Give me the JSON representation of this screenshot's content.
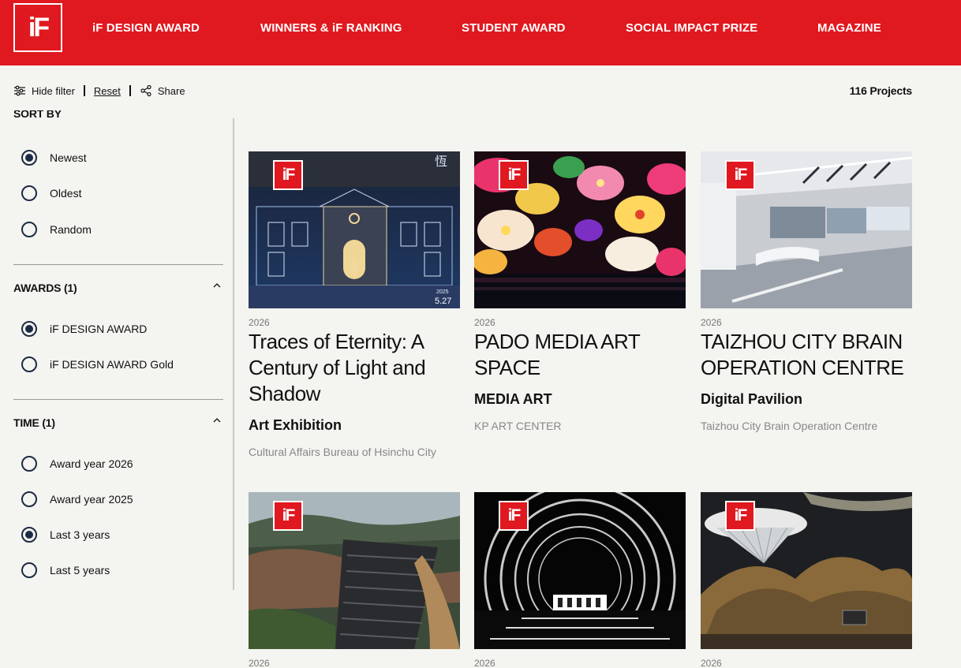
{
  "header": {
    "logo_text": "iF",
    "nav": [
      "iF DESIGN AWARD",
      "WINNERS & iF RANKING",
      "STUDENT AWARD",
      "SOCIAL IMPACT PRIZE",
      "MAGAZINE"
    ]
  },
  "toolbar": {
    "hide_filter": "Hide filter",
    "reset": "Reset",
    "share": "Share",
    "projects_count": "116 Projects"
  },
  "sidebar": {
    "sort_title": "SORT BY",
    "sort_options": [
      "Newest",
      "Oldest",
      "Random"
    ],
    "awards_title": "AWARDS (1)",
    "awards_options": [
      "iF DESIGN AWARD",
      "iF DESIGN AWARD Gold"
    ],
    "time_title": "TIME (1)",
    "time_options": [
      "Award year 2026",
      "Award year 2025",
      "Last 3 years",
      "Last 5 years"
    ]
  },
  "cards": [
    {
      "year": "2026",
      "title": "Traces of Eternity: A Century of Light and Shadow",
      "category": "Art Exhibition",
      "client": "Cultural Affairs Bureau of Hsinchu City",
      "img_text_1": "恆",
      "img_text_2": "2025",
      "img_text_3": "5.27"
    },
    {
      "year": "2026",
      "title": "PADO MEDIA ART SPACE",
      "category": "MEDIA ART",
      "client": "KP ART CENTER"
    },
    {
      "year": "2026",
      "title": "TAIZHOU CITY BRAIN OPERATION CENTRE",
      "category": "Digital Pavilion",
      "client": "Taizhou City Brain Operation Centre"
    },
    {
      "year": "2026"
    },
    {
      "year": "2026"
    },
    {
      "year": "2026"
    }
  ],
  "badge_text": "iF"
}
